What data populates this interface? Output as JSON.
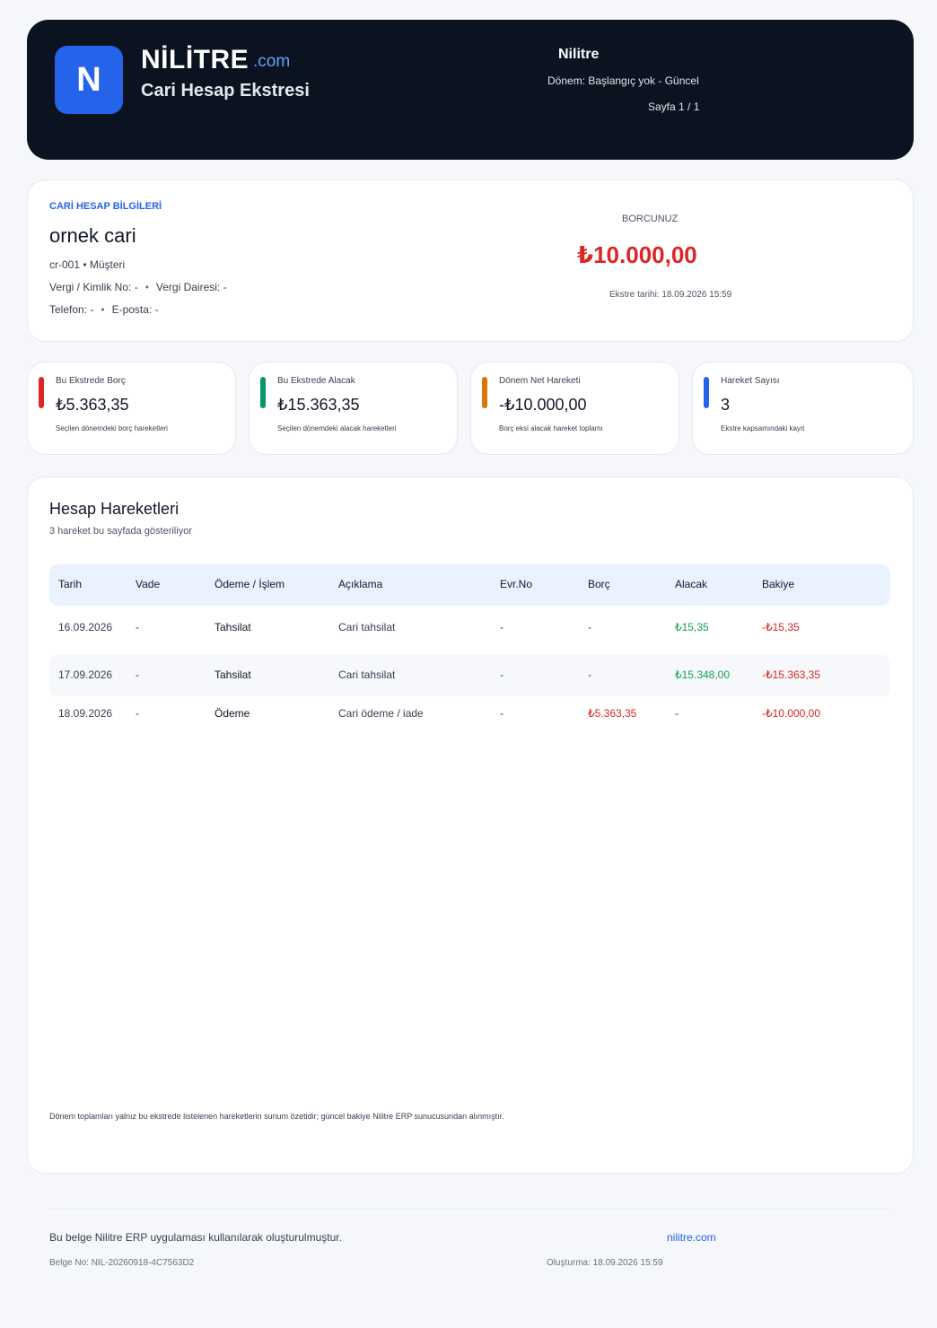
{
  "header": {
    "logo_letter": "N",
    "brand": "NİLİTRE",
    "brand_suffix": ".com",
    "subtitle": "Cari Hesap Ekstresi",
    "company": "Nilitre",
    "period": "Dönem: Başlangıç yok - Güncel",
    "page": "Sayfa 1 / 1"
  },
  "account": {
    "section_label": "CARİ HESAP BİLGİLERİ",
    "name": "ornek cari",
    "code_line": "cr-001 • Müşteri",
    "tax_no": "Vergi / Kimlik No: -",
    "tax_office": "Vergi Dairesi: -",
    "phone": "Telefon: -",
    "email": "E-posta: -",
    "balance_label": "BORCUNUZ",
    "balance_amount": "₺10.000,00",
    "statement_date": "Ekstre tarihi: 18.09.2026 15:59"
  },
  "kpis": [
    {
      "title": "Bu Ekstrede Borç",
      "value": "₺5.363,35",
      "note": "Seçilen dönemdeki borç hareketleri",
      "color": "#dc2626"
    },
    {
      "title": "Bu Ekstrede Alacak",
      "value": "₺15.363,35",
      "note": "Seçilen dönemdeki alacak hareketleri",
      "color": "#059669"
    },
    {
      "title": "Dönem Net Hareketi",
      "value": "-₺10.000,00",
      "note": "Borç eksi alacak hareket toplamı",
      "color": "#d97706"
    },
    {
      "title": "Hareket Sayısı",
      "value": "3",
      "note": "Ekstre kapsamındaki kayıt",
      "color": "#2563eb"
    }
  ],
  "movements": {
    "title": "Hesap Hareketleri",
    "subtitle": "3 hareket bu sayfada gösteriliyor",
    "columns": [
      "Tarih",
      "Vade",
      "Ödeme / İşlem",
      "Açıklama",
      "Evr.No",
      "Borç",
      "Alacak",
      "Bakiye"
    ],
    "rows": [
      {
        "date": "16.09.2026",
        "due": "-",
        "type": "Tahsilat",
        "desc": "Cari tahsilat",
        "doc": "-",
        "debit": "-",
        "credit": "₺15,35",
        "balance": "-₺15,35"
      },
      {
        "date": "17.09.2026",
        "due": "-",
        "type": "Tahsilat",
        "desc": "Cari tahsilat",
        "doc": "-",
        "debit": "-",
        "credit": "₺15.348,00",
        "balance": "-₺15.363,35"
      },
      {
        "date": "18.09.2026",
        "due": "-",
        "type": "Ödeme",
        "desc": "Cari ödeme / iade",
        "doc": "-",
        "debit": "₺5.363,35",
        "credit": "-",
        "balance": "-₺10.000,00"
      }
    ],
    "footnote": "Dönem toplamları yalnız bu ekstrede listelenen hareketlerin sunum özetidir; güncel bakiye Nilitre ERP sunucusundan alınmıştır."
  },
  "footer": {
    "text": "Bu belge Nilitre ERP uygulaması kullanılarak oluşturulmuştur.",
    "site": "nilitre.com",
    "doc_no": "Belge No: NIL-20260918-4C7563D2",
    "created": "Oluşturma: 18.09.2026 15:59"
  }
}
